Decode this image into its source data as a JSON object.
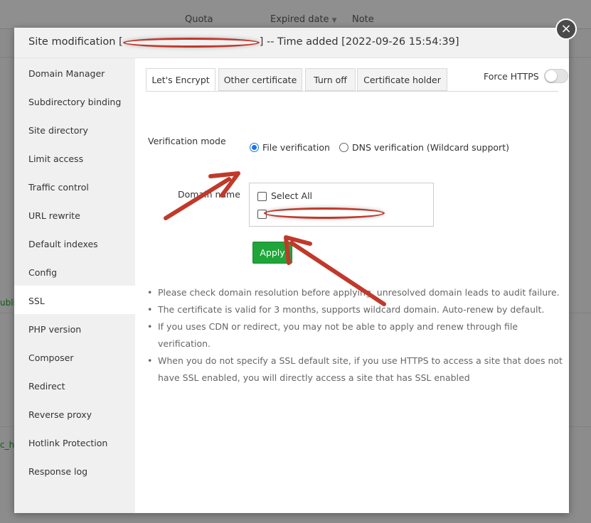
{
  "background": {
    "columns": [
      "Quota",
      "Expired date",
      "Note"
    ],
    "left_fragments": [
      "ubli",
      "c_h"
    ]
  },
  "modal": {
    "title_prefix": "Site modification [",
    "title_suffix": "] -- Time added [2022-09-26 15:54:39]",
    "close_icon": "×"
  },
  "sidebar": {
    "items": [
      {
        "label": "Domain Manager"
      },
      {
        "label": "Subdirectory binding"
      },
      {
        "label": "Site directory"
      },
      {
        "label": "Limit access"
      },
      {
        "label": "Traffic control"
      },
      {
        "label": "URL rewrite"
      },
      {
        "label": "Default indexes"
      },
      {
        "label": "Config"
      },
      {
        "label": "SSL",
        "active": true
      },
      {
        "label": "PHP version"
      },
      {
        "label": "Composer"
      },
      {
        "label": "Redirect"
      },
      {
        "label": "Reverse proxy"
      },
      {
        "label": "Hotlink Protection"
      },
      {
        "label": "Response log"
      }
    ]
  },
  "tabs": [
    {
      "label": "Let's Encrypt",
      "active": true
    },
    {
      "label": "Other certificate"
    },
    {
      "label": "Turn off"
    },
    {
      "label": "Certificate holder"
    }
  ],
  "force_https": {
    "label": "Force HTTPS",
    "enabled": false
  },
  "verification": {
    "label": "Verification mode",
    "options": [
      {
        "label": "File verification",
        "selected": true
      },
      {
        "label": "DNS verification (Wildcard support)",
        "selected": false
      }
    ]
  },
  "domain": {
    "label": "Domain name",
    "select_all": "Select All"
  },
  "apply_label": "Apply",
  "tips": [
    "Please check domain resolution before applying, unresolved domain leads to audit failure.",
    "The certificate is valid for 3 months, supports wildcard domain. Auto-renew by default.",
    "If you uses CDN or redirect, you may not be able to apply and renew through file verification.",
    "When you do not specify a SSL default site, if you use HTTPS to access a site that does not have SSL enabled, you will directly access a site that has SSL enabled"
  ],
  "colors": {
    "accent_green": "#20a53a",
    "annotation_red": "#c0392b",
    "radio_blue": "#1a73e8"
  }
}
